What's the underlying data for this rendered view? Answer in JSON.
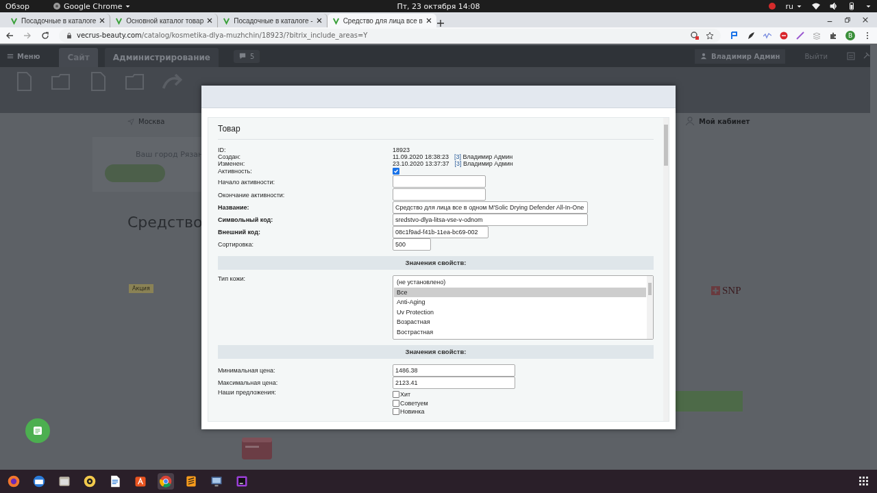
{
  "os_bar": {
    "activities": "Обзор",
    "app": "Google Chrome",
    "clock": "Пт, 23 октября 14:08",
    "language": "ru"
  },
  "browser": {
    "tabs": [
      {
        "title": "Посадочные в каталоге",
        "selected": false
      },
      {
        "title": "Основной каталог товар",
        "selected": false
      },
      {
        "title": "Посадочные в каталоге -",
        "selected": false
      },
      {
        "title": "Средство для лица все в",
        "selected": true
      }
    ],
    "url_host": "vecrus-beauty.com",
    "url_path": "/catalog/kosmetika-dlya-muzhchin/18923/?bitrix_include_areas=Y",
    "profile": "B"
  },
  "admin_panel": {
    "menu": "Меню",
    "tabs": [
      {
        "label": "Сайт",
        "selected": true
      },
      {
        "label": "Администрирование",
        "selected": false
      }
    ],
    "notifications": "5",
    "user": "Владимир Админ",
    "logout": "Выйти"
  },
  "site": {
    "city": "Москва",
    "city_prompt": "Ваш город Рязан",
    "product_title": "Средство",
    "account": "Мой кабинет",
    "sale_tag": "Акция",
    "brand": "SNP"
  },
  "dialog": {
    "title": "Товар",
    "fields": [
      {
        "kind": "plain",
        "label": "ID:",
        "value": "18923"
      },
      {
        "kind": "meta",
        "label": "Создан:",
        "value": "11.09.2020 18:38:23",
        "link": "[3]",
        "user": "Владимир Админ"
      },
      {
        "kind": "meta",
        "label": "Изменен:",
        "value": "23.10.2020 13:37:37",
        "link": "[3]",
        "user": "Владимир Админ"
      },
      {
        "kind": "checkbox",
        "label": "Активность:",
        "checked": true
      },
      {
        "kind": "date",
        "label": "Начало активности:",
        "required": false
      },
      {
        "kind": "date",
        "label": "Окончание активности:",
        "required": false
      },
      {
        "kind": "text",
        "label": "Название:",
        "required": true,
        "value": "Средство для лица все в одном M'Solic Drying Defender All-In-One"
      },
      {
        "kind": "text",
        "label": "Символьный код:",
        "required": true,
        "value": "sredstvo-dlya-litsa-vse-v-odnom"
      },
      {
        "kind": "code",
        "label": "Внешний код:",
        "required": true,
        "value": "08c1f9ad-f41b-11ea-bc69-002"
      },
      {
        "kind": "number",
        "label": "Сортировка:",
        "required": false,
        "value": "500"
      },
      {
        "kind": "section",
        "label": "Значения свойств:"
      },
      {
        "kind": "listbox",
        "label": "Тип кожи:",
        "options": [
          {
            "label": "(не установлено)",
            "selected": false
          },
          {
            "label": "Все",
            "selected": true
          },
          {
            "label": "Anti-Aging",
            "selected": false
          },
          {
            "label": "Uv Protection",
            "selected": false
          },
          {
            "label": "Возрастная",
            "selected": false
          },
          {
            "label": "Вострастная",
            "selected": false
          }
        ]
      },
      {
        "kind": "section",
        "label": "Значения свойств:"
      },
      {
        "kind": "price",
        "label": "Минимальная цена:",
        "required": false,
        "value": "1486.38"
      },
      {
        "kind": "price",
        "label": "Максимальная цена:",
        "required": false,
        "value": "2123.41"
      },
      {
        "kind": "checklist",
        "label": "Наши предложения:",
        "items": [
          {
            "label": "Хит",
            "checked": false
          },
          {
            "label": "Советуем",
            "checked": false
          },
          {
            "label": "Новинка",
            "checked": false
          }
        ]
      }
    ]
  }
}
